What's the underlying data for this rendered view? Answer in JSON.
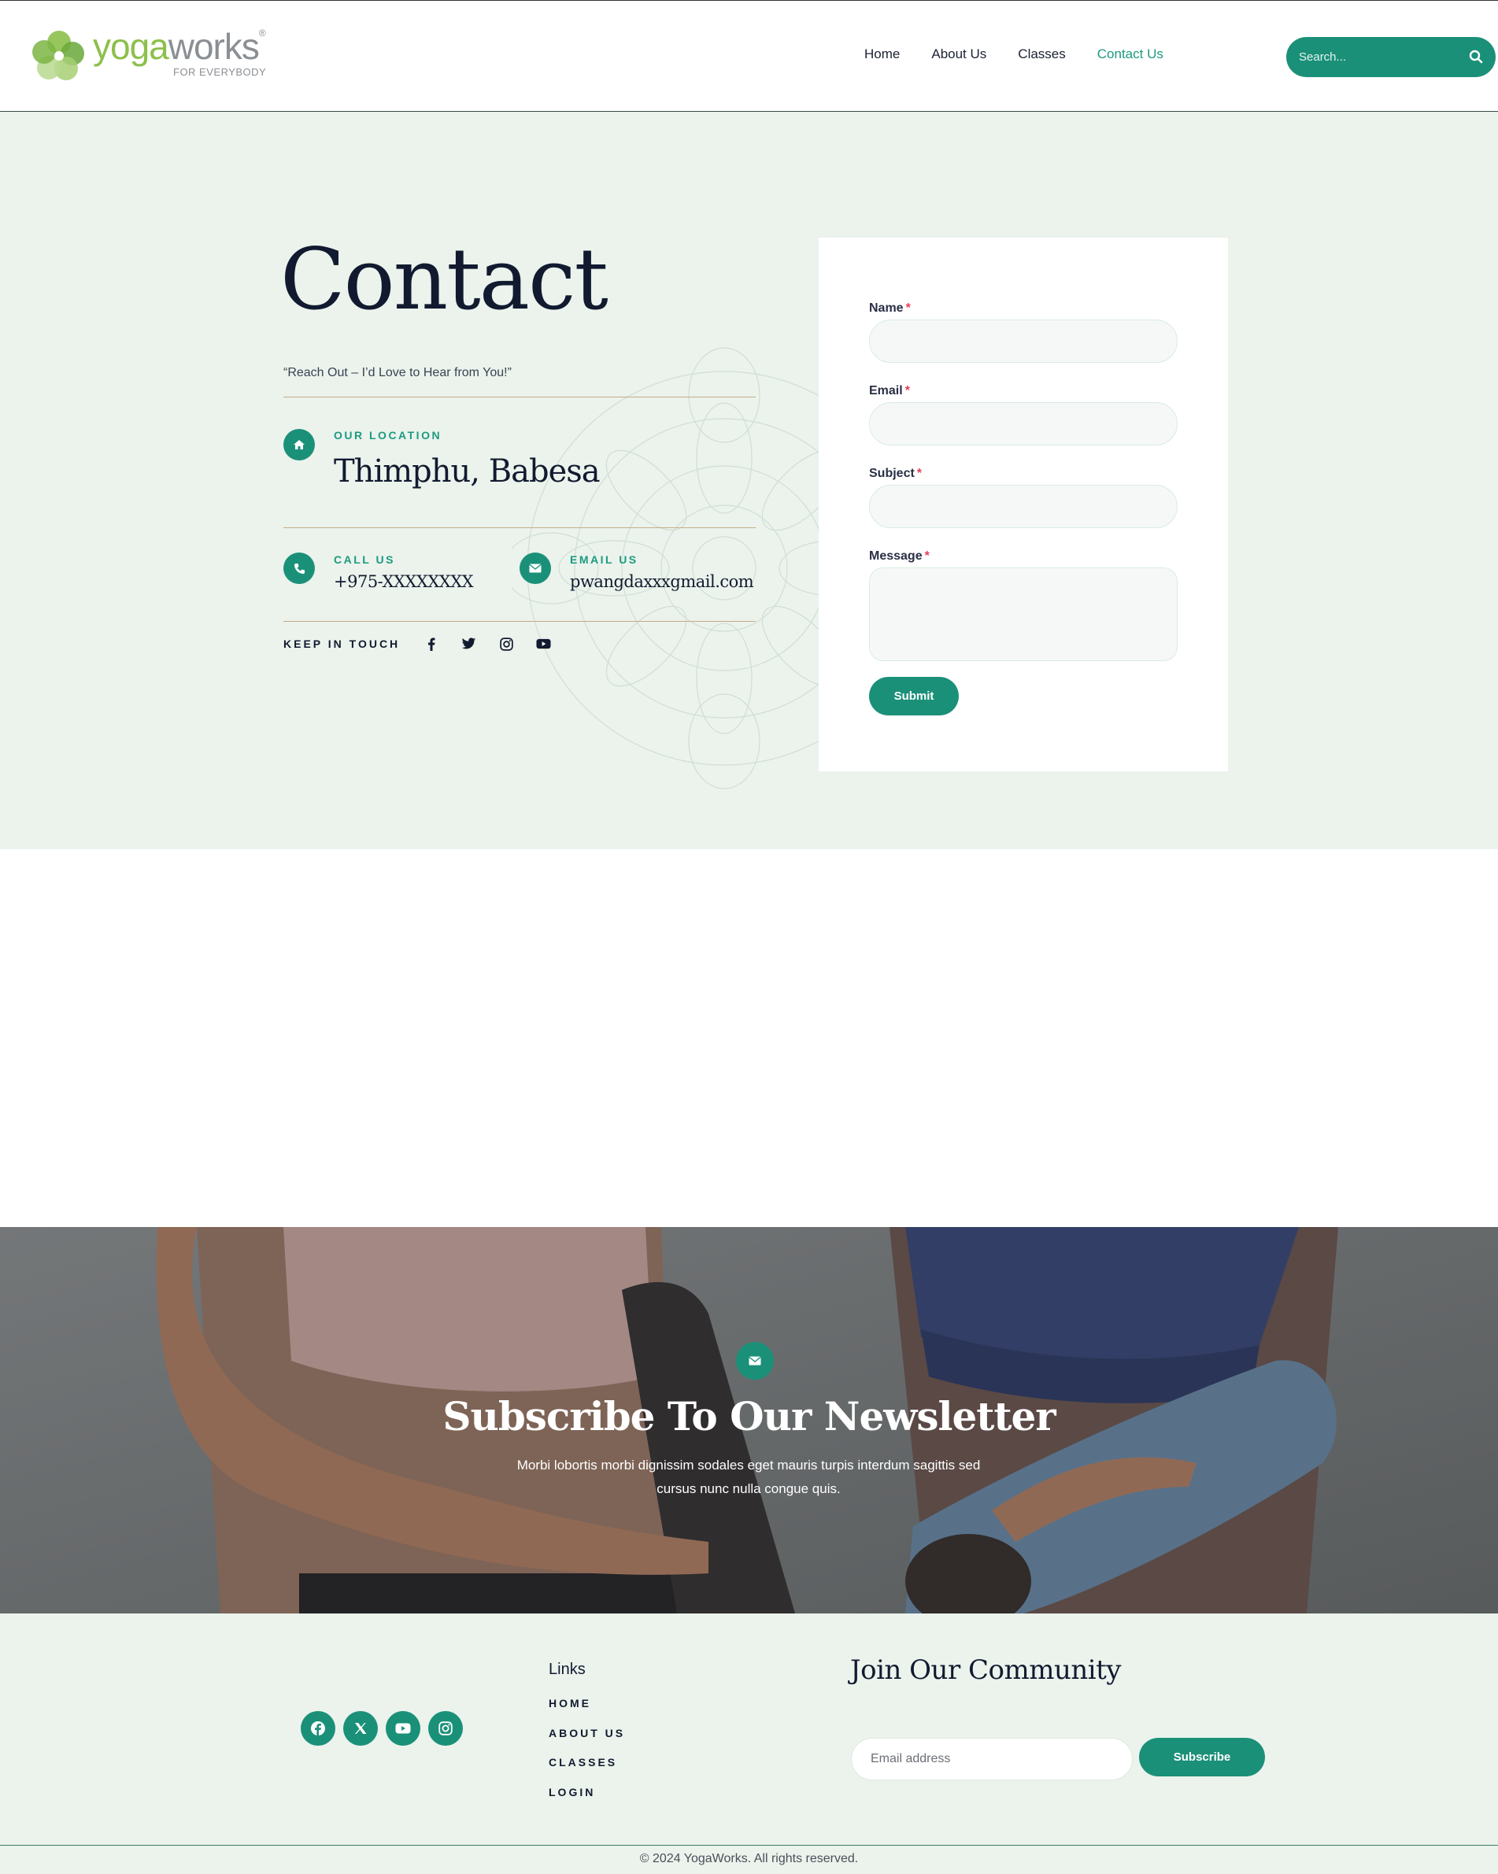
{
  "header": {
    "logo": {
      "word_part1": "yoga",
      "word_part2": "works",
      "registered": "®",
      "tagline": "FOR EVERYBODY"
    },
    "nav": [
      {
        "label": "Home"
      },
      {
        "label": "About Us"
      },
      {
        "label": "Classes"
      },
      {
        "label": "Contact Us",
        "active": true
      }
    ],
    "search": {
      "placeholder": "Search...",
      "icon": "search-icon"
    }
  },
  "contact": {
    "title": "Contact",
    "subtitle": "“Reach Out – I’d Love to Hear from You!”",
    "location": {
      "label": "OUR LOCATION",
      "value": "Thimphu, Babesa",
      "icon": "home-icon"
    },
    "call": {
      "label": "CALL US",
      "value": "+975-XXXXXXXX",
      "icon": "phone-icon"
    },
    "email": {
      "label": "EMAIL US",
      "value": "pwangdaxxxgmail.com",
      "icon": "envelope-icon"
    },
    "keep_in_touch": "KEEP IN TOUCH",
    "social_icons": [
      "facebook-icon",
      "twitter-icon",
      "instagram-icon",
      "youtube-icon"
    ]
  },
  "form": {
    "fields": [
      {
        "label": "Name",
        "required": "*"
      },
      {
        "label": "Email",
        "required": "*"
      },
      {
        "label": "Subject",
        "required": "*"
      },
      {
        "label": "Message",
        "required": "*"
      }
    ],
    "submit_label": "Submit"
  },
  "newsletter": {
    "icon": "envelope-icon",
    "title": "Subscribe To Our Newsletter",
    "text": "Morbi lobortis morbi dignissim sodales eget mauris turpis interdum sagittis sed cursus nunc nulla congue quis."
  },
  "footer": {
    "social_icons": [
      "facebook-icon",
      "x-icon",
      "youtube-icon",
      "instagram-icon"
    ],
    "links_title": "Links",
    "links": [
      "HOME",
      "ABOUT US",
      "CLASSES",
      "LOGIN"
    ],
    "join_title": "Join Our Community",
    "email_placeholder": "Email address",
    "subscribe_label": "Subscribe",
    "copyright": "© 2024 YogaWorks. All rights reserved."
  },
  "colors": {
    "accent": "#1b9079",
    "background_mint": "#ebf3ec",
    "rule_tan": "#c8ab84",
    "dark_text": "#121a30",
    "required_red": "#e53d5b"
  }
}
